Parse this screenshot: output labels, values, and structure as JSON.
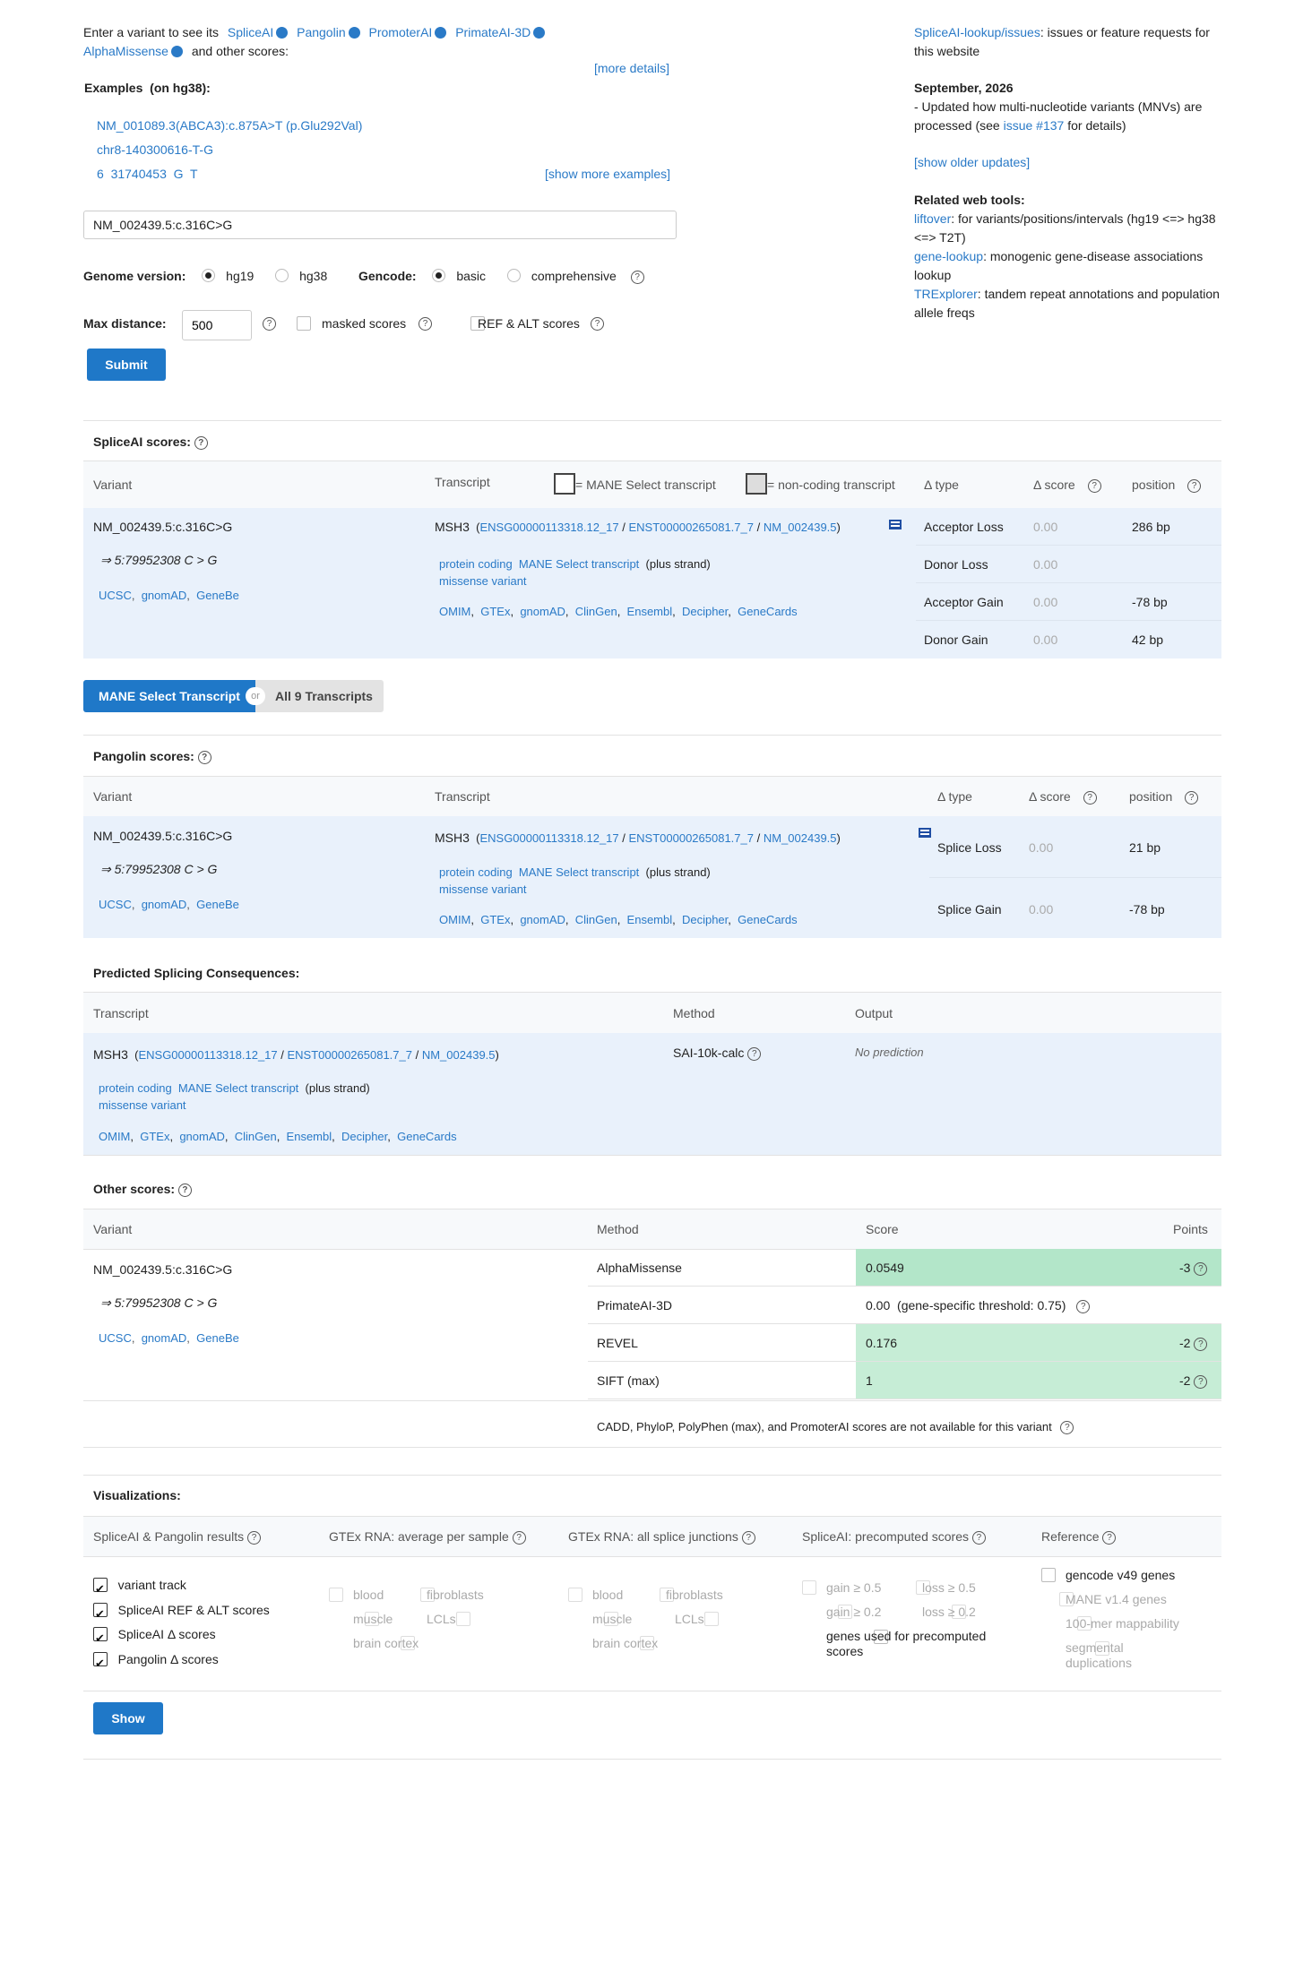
{
  "intro": {
    "prefix": "Enter a variant to see its",
    "tools": [
      "SpliceAI",
      "Pangolin",
      "PromoterAI",
      "PrimateAI-3D"
    ],
    "alpha": "AlphaMissense",
    "suffix": "and other scores:",
    "more_details": "[more details]",
    "examples_label": "Examples",
    "examples_note": "(on hg38):",
    "ex1": "NM_001089.3(ABCA3):c.875A>T (p.Glu292Val)",
    "ex2": "chr8-140300616-T-G",
    "ex3": "6  31740453  G  T",
    "show_more": "[show more examples]"
  },
  "form": {
    "variant_value": "NM_002439.5:c.316C>G",
    "genome_label": "Genome version:",
    "hg19": "hg19",
    "hg38": "hg38",
    "gencode_label": "Gencode:",
    "basic": "basic",
    "comprehensive": "comprehensive",
    "maxdist_label": "Max distance:",
    "maxdist_value": "500",
    "masked": "masked scores",
    "refalt": "REF & ALT scores",
    "submit": "Submit"
  },
  "news": {
    "issues_link": "SpliceAI-lookup/issues",
    "issues_text": ": issues or feature requests for this website",
    "date": "September, 2026",
    "update_text": "- Updated how multi-nucleotide variants (MNVs) are processed (see",
    "issue_link": "issue #137",
    "update_end": "for details)",
    "older": "[show older updates]",
    "related": "Related web tools:",
    "liftover": "liftover",
    "liftover_text": ": for variants/positions/intervals (hg19 <=> hg38 <=> T2T)",
    "genelookup": "gene-lookup",
    "genelookup_text": ": monogenic gene-disease associations lookup",
    "trexplorer": "TRExplorer",
    "trexplorer_text": ": tandem repeat annotations and population allele freqs"
  },
  "common": {
    "variant": "NM_002439.5:c.316C>G",
    "coord": "⇒ 5:79952308 C > G",
    "links": [
      "UCSC",
      "gnomAD",
      "GeneBe"
    ],
    "gene": "MSH3",
    "ensg": "ENSG00000113318.12_17",
    "enst": "ENST00000265081.7_7",
    "nm": "NM_002439.5",
    "biotype": "protein coding",
    "mane": "MANE Select transcript",
    "strand": "(plus strand)",
    "consequence": "missense variant",
    "gene_links": [
      "OMIM",
      "GTEx",
      "gnomAD",
      "ClinGen",
      "Ensembl",
      "Decipher",
      "GeneCards"
    ]
  },
  "spliceai": {
    "title": "SpliceAI scores:",
    "h_variant": "Variant",
    "h_transcript": "Transcript",
    "legend_mane": "= MANE Select transcript",
    "legend_noncoding": "= non-coding transcript",
    "h_type": "Δ type",
    "h_score": "Δ score",
    "h_position": "position",
    "rows": [
      {
        "type": "Acceptor Loss",
        "score": "0.00",
        "position": "286 bp"
      },
      {
        "type": "Donor Loss",
        "score": "0.00",
        "position": ""
      },
      {
        "type": "Acceptor Gain",
        "score": "0.00",
        "position": "-78 bp"
      },
      {
        "type": "Donor Gain",
        "score": "0.00",
        "position": "42 bp"
      }
    ]
  },
  "toggle": {
    "mane": "MANE Select Transcript",
    "or": "or",
    "all": "All 9 Transcripts"
  },
  "pangolin": {
    "title": "Pangolin scores:",
    "h_variant": "Variant",
    "h_transcript": "Transcript",
    "h_type": "Δ type",
    "h_score": "Δ score",
    "h_position": "position",
    "rows": [
      {
        "type": "Splice Loss",
        "score": "0.00",
        "position": "21 bp"
      },
      {
        "type": "Splice Gain",
        "score": "0.00",
        "position": "-78 bp"
      }
    ]
  },
  "consequences": {
    "title": "Predicted Splicing Consequences:",
    "h_transcript": "Transcript",
    "h_method": "Method",
    "h_output": "Output",
    "method": "SAI-10k-calc",
    "output": "No prediction"
  },
  "other": {
    "title": "Other scores:",
    "h_variant": "Variant",
    "h_method": "Method",
    "h_score": "Score",
    "h_points": "Points",
    "rows": [
      {
        "method": "AlphaMissense",
        "score": "0.0549",
        "points": "-3"
      },
      {
        "method": "PrimateAI-3D",
        "score": "0.00",
        "note": "(gene-specific threshold: 0.75)",
        "points": ""
      },
      {
        "method": "REVEL",
        "score": "0.176",
        "points": "-2"
      },
      {
        "method": "SIFT (max)",
        "score": "1",
        "points": "-2"
      }
    ],
    "na_note": "CADD,  PhyloP,  PolyPhen (max),  and PromoterAI scores are not available for this variant"
  },
  "viz": {
    "title": "Visualizations:",
    "h1": "SpliceAI & Pangolin results",
    "h2": "GTEx RNA: average per sample",
    "h3": "GTEx RNA: all splice junctions",
    "h4": "SpliceAI: precomputed scores",
    "h5": "Reference",
    "c1": [
      "variant track",
      "SpliceAI REF & ALT scores",
      "SpliceAI Δ  scores",
      "Pangolin Δ  scores"
    ],
    "blood": "blood",
    "fibroblasts": "fibroblasts",
    "muscle": "muscle",
    "lcls": "LCLs",
    "cortex": "brain cortex",
    "gain05": "gain ≥ 0.5",
    "loss05": "loss ≥ 0.5",
    "gain02": "gain ≥ 0.2",
    "loss02": "loss ≥ 0.2",
    "genes_used": "genes used for precomputed scores",
    "ref": [
      "gencode v49 genes",
      "MANE v1.4 genes",
      "100-mer mappability",
      "segmental duplications"
    ],
    "show": "Show"
  }
}
